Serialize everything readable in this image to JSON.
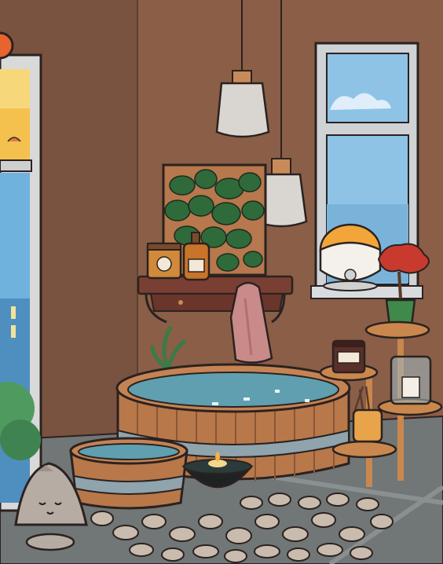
{
  "scene": {
    "room": "bathroom",
    "colors": {
      "wall": "#8a5e47",
      "wall_shadow": "#6f4a38",
      "floor": "#6f7474",
      "wood": "#b8784a",
      "water": "#5f9fb0",
      "sky": "#8fc3e6",
      "outline": "#2b2220"
    }
  },
  "icons": {
    "menu_button": "orange-circle-button-icon"
  }
}
